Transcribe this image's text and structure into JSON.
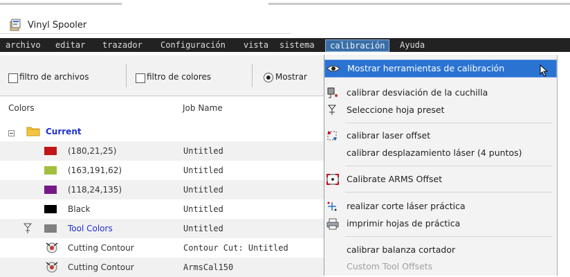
{
  "window": {
    "title": "Vinyl Spooler"
  },
  "menubar": {
    "items": [
      "archivo",
      "editar",
      "trazador",
      "Configuración",
      "vista",
      "sistema",
      "calibración",
      "Ayuda"
    ],
    "active_index": 6
  },
  "toolbar": {
    "file_filter_label": "filtro de archivos",
    "color_filter_label": "filtro de colores",
    "show_option_label": "Mostrar"
  },
  "grid": {
    "headers": {
      "colors": "Colors",
      "job_name": "Job Name"
    },
    "rows": [
      {
        "color": "",
        "label": "Current",
        "job": "",
        "kind": "group"
      },
      {
        "color": "#c01619",
        "label": "(180,21,25)",
        "job": "Untitled"
      },
      {
        "color": "#a3bf3e",
        "label": "(163,191,62)",
        "job": "Untitled"
      },
      {
        "color": "#761887",
        "label": "(118,24,135)",
        "job": "Untitled"
      },
      {
        "color": "#000000",
        "label": "Black",
        "job": "Untitled"
      },
      {
        "color": "#808080",
        "label": "Tool Colors",
        "job": "Untitled",
        "kind": "tool"
      },
      {
        "color": "",
        "label": "Cutting Contour",
        "job": "Contour Cut: Untitled",
        "kind": "contour"
      },
      {
        "color": "",
        "label": "Cutting Contour",
        "job": "ArmsCal150",
        "kind": "contour"
      }
    ]
  },
  "calibration_menu": {
    "items": [
      {
        "label": "Mostrar herramientas de calibración",
        "icon": "eye-icon",
        "highlighted": true
      },
      {
        "label": "calibrar desviación de la cuchilla",
        "icon": "blade-offset-icon"
      },
      {
        "label": "Seleccione hoja preset",
        "icon": "sheet-preset-icon"
      },
      {
        "label": "calibrar laser offset",
        "icon": "laser-offset-icon"
      },
      {
        "label": "calibrar desplazamiento láser (4 puntos)",
        "icon": ""
      },
      {
        "label": "Calibrate ARMS Offset",
        "icon": "arms-target-icon"
      },
      {
        "label": "realizar corte láser práctica",
        "icon": "laser-cut-icon"
      },
      {
        "label": "imprimir hojas de práctica",
        "icon": "printer-icon"
      },
      {
        "label": "calibrar balanza cortador",
        "icon": ""
      },
      {
        "label": "Custom Tool Offsets",
        "icon": "",
        "disabled": true
      }
    ]
  }
}
